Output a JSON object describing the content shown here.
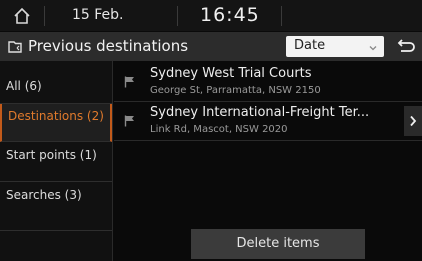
{
  "status": {
    "date": "15 Feb.",
    "time": "16:45"
  },
  "header": {
    "title": "Previous destinations",
    "sort": {
      "selected": "Date"
    }
  },
  "menu": {
    "items": [
      {
        "label": "All (6)",
        "selected": false
      },
      {
        "label": "Destinations (2)",
        "selected": true
      },
      {
        "label": "Start points (1)",
        "selected": false
      },
      {
        "label": "Searches (3)",
        "selected": false
      }
    ]
  },
  "list": {
    "items": [
      {
        "name": "Sydney West Trial Courts",
        "address": "George St, Parramatta, NSW 2150"
      },
      {
        "name": "Sydney International-Freight Ter...",
        "address": "Link Rd, Mascot, NSW 2020"
      }
    ]
  },
  "actions": {
    "delete_label": "Delete items"
  },
  "colors": {
    "accent": "#e07a2c",
    "background": "#0a0a0a"
  },
  "icons": [
    "home-icon",
    "folder-history-icon",
    "chevron-down-icon",
    "back-icon",
    "flag-icon",
    "chevron-right-icon"
  ]
}
